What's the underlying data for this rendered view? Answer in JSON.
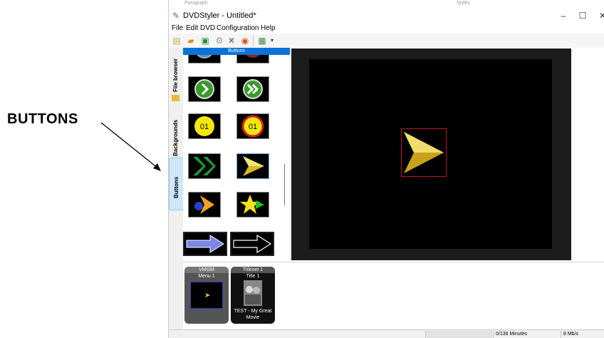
{
  "annotation": {
    "label": "BUTTONS"
  },
  "window": {
    "background_header_left": "Paragraph",
    "background_header_right": "Styles",
    "title": "DVDStyler - Untitled*",
    "controls": {
      "minimize": "–",
      "maximize": "☐",
      "close": "✕"
    }
  },
  "menu": [
    "File",
    "Edit",
    "DVD",
    "Configuration",
    "Help"
  ],
  "toolbar": {
    "icons": [
      "new-icon",
      "open-icon",
      "save-icon",
      "settings-icon",
      "tools-icon",
      "burn-icon",
      "add-file-icon"
    ]
  },
  "side_tabs": [
    {
      "label": "File browser",
      "active": false
    },
    {
      "label": "Backgrounds",
      "active": false
    },
    {
      "label": "Buttons",
      "active": true
    }
  ],
  "palette": {
    "title": "Buttons",
    "items": [
      {
        "name": "button-round-partial-left"
      },
      {
        "name": "button-round-red-partial"
      },
      {
        "name": "button-green-play"
      },
      {
        "name": "button-green-forward"
      },
      {
        "name": "button-yellow-number",
        "text": "01"
      },
      {
        "name": "button-yellow-red-ring-number",
        "text": "01"
      },
      {
        "name": "button-green-double-chevron"
      },
      {
        "name": "button-gold-arrow"
      },
      {
        "name": "button-orange-arrow-ball"
      },
      {
        "name": "button-yellow-star-arrow"
      },
      {
        "name": "button-blue-arrow"
      },
      {
        "name": "button-outline-arrow"
      }
    ]
  },
  "titleset_manager": {
    "vmgm": {
      "header": "VMGM",
      "menu": "Menu 1"
    },
    "titleset": {
      "header": "Titleset 1",
      "title": "Title 1",
      "caption_line1": "TEST - My Great",
      "caption_line2": "Movie"
    }
  },
  "status_bar": {
    "duration": "0/136 Minutes",
    "bitrate": "8 Mb/s"
  },
  "colors": {
    "selection_tab": "#cfe6fb",
    "palette_header": "#0b73d6",
    "selection_box": "#c01818"
  }
}
